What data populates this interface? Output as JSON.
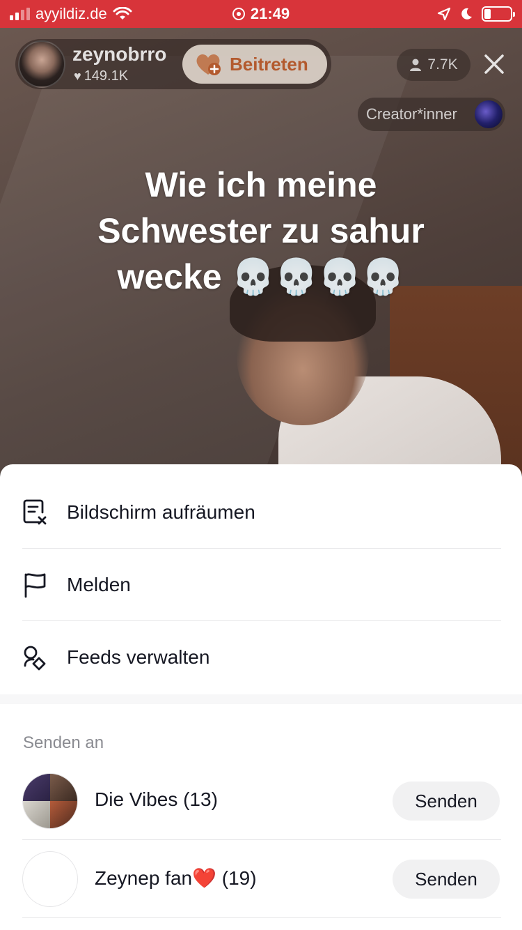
{
  "status_bar": {
    "carrier": "ayyildiz.de",
    "time": "21:49",
    "battery_level": 0.25
  },
  "live": {
    "host_name": "zeynobrro",
    "host_likes": "149.1K",
    "join_label": "Beitreten",
    "viewer_count": "7.7K",
    "creator_label": "Creator*inner",
    "caption": "Wie ich meine Schwester zu sahur wecke 💀💀💀💀"
  },
  "menu": {
    "items": [
      {
        "label": "Bildschirm aufräumen",
        "icon": "clear-screen-icon"
      },
      {
        "label": "Melden",
        "icon": "flag-icon"
      },
      {
        "label": "Feeds verwalten",
        "icon": "feed-manage-icon"
      }
    ]
  },
  "share": {
    "title": "Senden an",
    "contacts": [
      {
        "name": "Die Vibes (13)",
        "button": "Senden"
      },
      {
        "name": "Zeynep fan❤️ (19)",
        "button": "Senden"
      }
    ]
  },
  "colors": {
    "status_bar": "#d8343a",
    "join_text": "#b35a2e",
    "text_primary": "#161823",
    "text_secondary": "#8a8b91"
  }
}
